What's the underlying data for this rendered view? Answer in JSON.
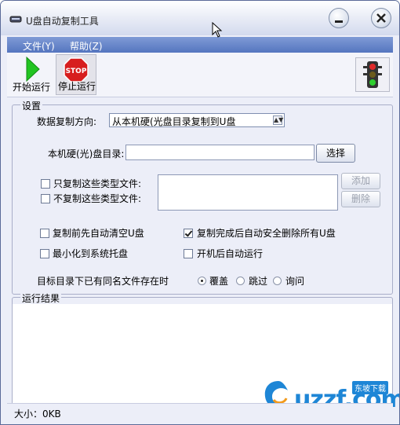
{
  "window": {
    "title": "U盘自动复制工具"
  },
  "menu": {
    "file": "文件(Y)",
    "help": "帮助(Z)"
  },
  "toolbar": {
    "start": "开始运行",
    "stop": "停止运行",
    "stop_sign": "STOP"
  },
  "settings": {
    "group_title": "设置",
    "direction_label": "数据复制方向:",
    "direction_value": "从本机硬(光盘目录复制到U盘",
    "dir_label": "本机硬(光)盘目录:",
    "dir_value": "",
    "choose_btn": "选择",
    "only_copy_label": "只复制这些类型文件:",
    "no_copy_label": "不复制这些类型文件:",
    "add_btn": "添加",
    "delete_btn": "删除",
    "clear_before_label": "复制前先自动清空U盘",
    "clear_before_checked": false,
    "safe_remove_label": "复制完成后自动安全删除所有U盘",
    "safe_remove_checked": true,
    "minimize_label": "最小化到系统托盘",
    "minimize_checked": false,
    "autorun_label": "开机后自动运行",
    "autorun_checked": false,
    "conflict_label": "目标目录下已有同名文件存在时",
    "conflict_options": [
      "覆盖",
      "跳过",
      "询问"
    ],
    "conflict_selected": "覆盖"
  },
  "results": {
    "group_title": "运行结果"
  },
  "status": {
    "size": "大小：0KB"
  },
  "watermark": {
    "text": "uzzf.com",
    "badge": "东坡下载"
  }
}
